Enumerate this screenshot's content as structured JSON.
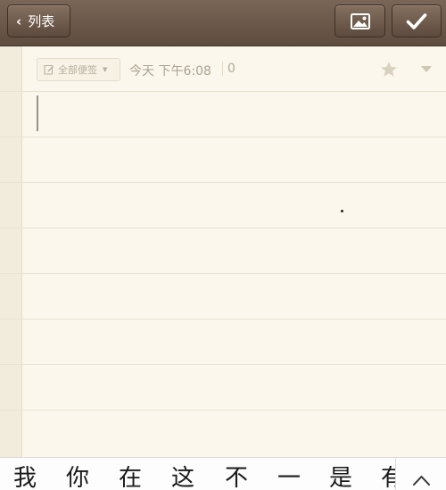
{
  "topbar": {
    "back_label": "列表",
    "back_icon": "chevron-left-icon",
    "image_icon": "image-icon",
    "done_icon": "checkmark-icon"
  },
  "note": {
    "folder_tag": "全部便签",
    "date": "今天 下午6:08",
    "char_count": "0",
    "star_icon": "star-icon",
    "menu_icon": "caret-down-icon",
    "body": ""
  },
  "keyboard": {
    "candidates": [
      "我",
      "你",
      "在",
      "这",
      "不",
      "一",
      "是",
      "有"
    ],
    "expand_icon": "chevron-up-icon"
  },
  "colors": {
    "toolbar": "#6b5748",
    "paper": "#fbf7ec",
    "ruled_line": "#e9e3d4",
    "meta_text": "#aaa293"
  }
}
